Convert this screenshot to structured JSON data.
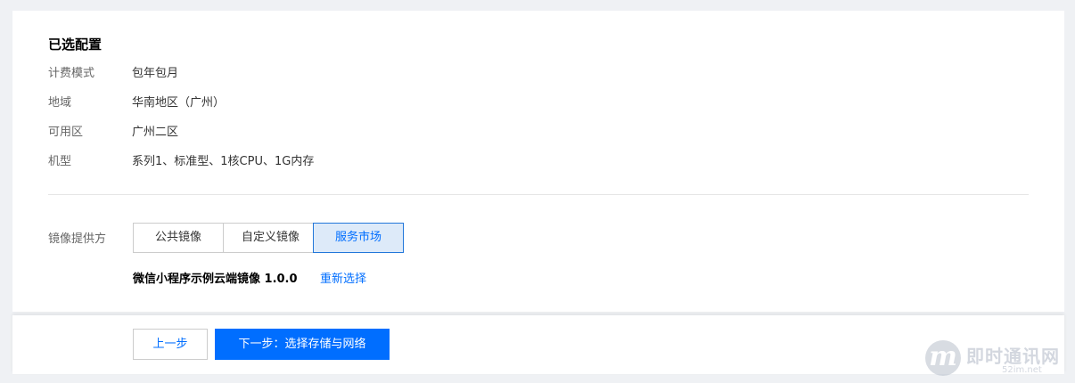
{
  "selected_config": {
    "title": "已选配置",
    "rows": [
      {
        "label": "计费模式",
        "value": "包年包月"
      },
      {
        "label": "地域",
        "value": "华南地区（广州）"
      },
      {
        "label": "可用区",
        "value": "广州二区"
      },
      {
        "label": "机型",
        "value": "系列1、标准型、1核CPU、1G内存"
      }
    ]
  },
  "image_provider": {
    "label": "镜像提供方",
    "options": [
      "公共镜像",
      "自定义镜像",
      "服务市场"
    ],
    "selected_option": "服务市场",
    "selected_image": "微信小程序示例云端镜像 1.0.0",
    "reselect_label": "重新选择"
  },
  "footer": {
    "prev_label": "上一步",
    "next_label": "下一步：选择存储与网络"
  },
  "watermark": {
    "logo_letter": "m",
    "title": "即时通讯网",
    "subtitle": "52im.net"
  },
  "colors": {
    "accent": "#006eff",
    "active_bg": "#ddeaf9",
    "page_bg": "#eff1f4"
  }
}
